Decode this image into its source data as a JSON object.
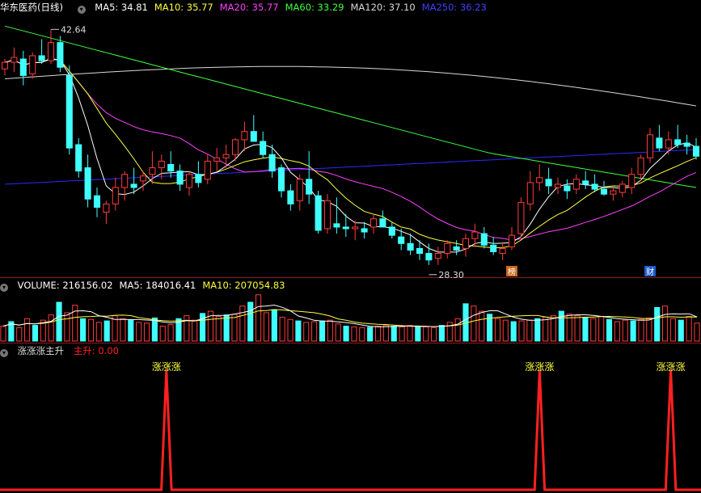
{
  "stock": {
    "name": "华东医药",
    "period": "(日线)"
  },
  "colors": {
    "up": "#ff3b3b",
    "down": "#40ffff",
    "ma5": "#ffffff",
    "ma10": "#ffff40",
    "ma20": "#ff40ff",
    "ma60": "#40ff40",
    "ma120": "#d8d8d8",
    "ma250": "#2a2aff",
    "signal": "#ff2020",
    "bg": "#000000"
  },
  "main_panel": {
    "indicators": [
      {
        "label": "MA5: 34.81",
        "color": "#ffffff"
      },
      {
        "label": "MA10: 35.77",
        "color": "#ffff40"
      },
      {
        "label": "MA20: 35.77",
        "color": "#ff40ff"
      },
      {
        "label": "MA60: 33.29",
        "color": "#40ff40"
      },
      {
        "label": "MA120: 37.10",
        "color": "#d8d8d8"
      },
      {
        "label": "MA250: 36.23",
        "color": "#4040ff"
      }
    ],
    "high_label": "42.64",
    "low_label": "28.30",
    "badges": [
      "榜",
      "财"
    ]
  },
  "volume_panel": {
    "indicators": [
      {
        "label": "VOLUME: 216156.02",
        "color": "#ffffff"
      },
      {
        "label": "MA5: 184016.41",
        "color": "#ffffff"
      },
      {
        "label": "MA10: 207054.83",
        "color": "#ffff40"
      }
    ]
  },
  "signal_panel": {
    "title": "涨涨涨主升",
    "indicator": {
      "label": "主升: 0.00",
      "color": "#ff2020"
    },
    "peak_label": "涨涨涨"
  },
  "chart_data": [
    {
      "type": "candlestick",
      "candles": [
        [
          40.2,
          40.8,
          39.8,
          40.6
        ],
        [
          40.6,
          41.5,
          40.0,
          40.9
        ],
        [
          40.8,
          41.3,
          39.2,
          39.8
        ],
        [
          39.9,
          41.2,
          39.6,
          41.0
        ],
        [
          41.0,
          42.0,
          40.5,
          40.7
        ],
        [
          40.7,
          42.6,
          40.5,
          41.8
        ],
        [
          41.8,
          42.2,
          40.0,
          40.3
        ],
        [
          39.8,
          40.4,
          35.0,
          35.4
        ],
        [
          35.6,
          36.0,
          33.6,
          34.0
        ],
        [
          34.2,
          35.0,
          31.8,
          32.3
        ],
        [
          32.5,
          33.0,
          31.2,
          31.8
        ],
        [
          31.5,
          32.2,
          30.8,
          32.0
        ],
        [
          32.0,
          33.6,
          31.6,
          33.0
        ],
        [
          33.0,
          34.0,
          32.2,
          33.8
        ],
        [
          33.2,
          34.2,
          32.6,
          33.0
        ],
        [
          33.4,
          34.0,
          32.8,
          33.7
        ],
        [
          33.8,
          35.2,
          33.2,
          34.2
        ],
        [
          34.2,
          35.0,
          33.5,
          34.6
        ],
        [
          34.4,
          35.2,
          33.6,
          34.0
        ],
        [
          34.0,
          34.4,
          32.8,
          33.2
        ],
        [
          33.0,
          34.0,
          32.5,
          33.8
        ],
        [
          33.8,
          34.6,
          33.0,
          33.3
        ],
        [
          33.5,
          35.0,
          33.2,
          34.6
        ],
        [
          34.6,
          35.4,
          34.0,
          34.8
        ],
        [
          34.8,
          35.6,
          34.2,
          35.0
        ],
        [
          35.0,
          36.0,
          34.6,
          35.9
        ],
        [
          35.9,
          37.0,
          35.2,
          36.4
        ],
        [
          36.4,
          37.4,
          35.8,
          35.8
        ],
        [
          35.8,
          36.4,
          34.8,
          35.0
        ],
        [
          35.0,
          35.6,
          33.6,
          34.0
        ],
        [
          34.2,
          34.4,
          32.4,
          32.8
        ],
        [
          32.8,
          33.2,
          31.6,
          32.0
        ],
        [
          32.2,
          33.8,
          31.6,
          33.5
        ],
        [
          33.5,
          35.2,
          32.0,
          32.6
        ],
        [
          32.5,
          32.8,
          30.2,
          30.4
        ],
        [
          30.5,
          32.6,
          30.2,
          32.2
        ],
        [
          30.8,
          32.4,
          30.2,
          30.6
        ],
        [
          30.6,
          31.4,
          30.0,
          30.5
        ],
        [
          30.5,
          31.0,
          29.8,
          30.6
        ],
        [
          30.5,
          30.9,
          29.9,
          30.3
        ],
        [
          30.6,
          31.4,
          30.2,
          31.1
        ],
        [
          31.1,
          31.6,
          30.6,
          30.6
        ],
        [
          30.6,
          30.9,
          29.9,
          30.1
        ],
        [
          30.0,
          30.5,
          29.2,
          29.6
        ],
        [
          29.6,
          30.2,
          28.9,
          29.2
        ],
        [
          29.3,
          29.8,
          28.6,
          29.0
        ],
        [
          29.0,
          29.6,
          28.3,
          28.6
        ],
        [
          28.7,
          29.4,
          28.3,
          29.0
        ],
        [
          29.0,
          29.8,
          28.7,
          29.6
        ],
        [
          29.4,
          29.8,
          28.9,
          29.2
        ],
        [
          29.3,
          30.2,
          28.8,
          29.9
        ],
        [
          29.9,
          30.8,
          29.4,
          30.3
        ],
        [
          30.2,
          30.6,
          29.3,
          29.5
        ],
        [
          29.5,
          30.0,
          28.9,
          29.1
        ],
        [
          29.0,
          29.7,
          28.6,
          29.3
        ],
        [
          29.4,
          30.6,
          29.2,
          30.1
        ],
        [
          30.2,
          32.4,
          30.0,
          32.1
        ],
        [
          32.0,
          34.0,
          31.6,
          33.3
        ],
        [
          33.3,
          34.4,
          32.8,
          33.6
        ],
        [
          33.5,
          34.2,
          32.6,
          33.1
        ],
        [
          33.0,
          33.6,
          32.6,
          33.2
        ],
        [
          33.1,
          33.5,
          32.3,
          32.8
        ],
        [
          32.9,
          33.8,
          32.6,
          33.5
        ],
        [
          33.4,
          34.0,
          32.9,
          33.2
        ],
        [
          33.2,
          33.8,
          32.7,
          32.9
        ],
        [
          32.9,
          33.4,
          32.5,
          32.6
        ],
        [
          32.6,
          33.0,
          32.2,
          32.8
        ],
        [
          32.7,
          33.4,
          32.4,
          33.2
        ],
        [
          33.0,
          34.2,
          32.6,
          33.8
        ],
        [
          33.8,
          35.0,
          33.4,
          34.8
        ],
        [
          34.8,
          36.6,
          34.5,
          36.2
        ],
        [
          36.0,
          36.8,
          35.2,
          35.4
        ],
        [
          35.4,
          36.4,
          35.0,
          35.9
        ],
        [
          35.9,
          36.8,
          35.4,
          35.6
        ],
        [
          35.7,
          36.2,
          35.0,
          35.5
        ],
        [
          35.5,
          36.0,
          34.7,
          34.9
        ]
      ],
      "high_label": 42.64,
      "low_label": 28.3,
      "ylim": [
        27.8,
        43.5
      ]
    },
    {
      "type": "bar",
      "name": "VOLUME",
      "values": [
        200,
        260,
        180,
        300,
        210,
        280,
        350,
        520,
        380,
        480,
        300,
        290,
        250,
        270,
        340,
        300,
        280,
        250,
        240,
        310,
        200,
        220,
        300,
        340,
        280,
        370,
        400,
        330,
        350,
        360,
        470,
        520,
        620,
        380,
        420,
        320,
        290,
        270,
        250,
        260,
        270,
        280,
        230,
        200,
        190,
        180,
        185,
        200,
        210,
        200,
        190,
        210,
        200,
        190,
        180,
        210,
        250,
        300,
        500,
        470,
        400,
        360,
        300,
        280,
        260,
        270,
        280,
        300,
        320,
        340,
        400,
        360,
        340,
        320,
        300,
        330,
        290,
        260,
        280,
        270,
        290,
        310,
        450,
        470,
        300,
        280,
        330,
        240
      ],
      "ylim": [
        0,
        650
      ]
    },
    {
      "type": "line",
      "name": "主升",
      "values": [
        0,
        0,
        0,
        0,
        0,
        0,
        0,
        0,
        0,
        0,
        0,
        0,
        0,
        0,
        0,
        0,
        0,
        0,
        0,
        0,
        0,
        0,
        0,
        0,
        0,
        0,
        0,
        0,
        0,
        0,
        0,
        0,
        0,
        1,
        0,
        0,
        0,
        0,
        0,
        0,
        0,
        0,
        0,
        0,
        0,
        0,
        0,
        0,
        0,
        0,
        0,
        0,
        0,
        0,
        0,
        0,
        0,
        0,
        0,
        0,
        0,
        0,
        0,
        0,
        0,
        0,
        0,
        0,
        0,
        0,
        0,
        0,
        0,
        0,
        0,
        0,
        0,
        0,
        0,
        0,
        0,
        0,
        0,
        0,
        0,
        0,
        0,
        0,
        0,
        0,
        0,
        0,
        0,
        0,
        0,
        0,
        0,
        0,
        0,
        0,
        0,
        0,
        0,
        0,
        0,
        0,
        0,
        1,
        0,
        0,
        0,
        0,
        0,
        0,
        0,
        0,
        0,
        0,
        0,
        0,
        0,
        0,
        0,
        0,
        0,
        0,
        0,
        0,
        0,
        0,
        0,
        0,
        0,
        1,
        0,
        0,
        0,
        0,
        0,
        0
      ],
      "ylim": [
        0,
        1
      ]
    }
  ]
}
